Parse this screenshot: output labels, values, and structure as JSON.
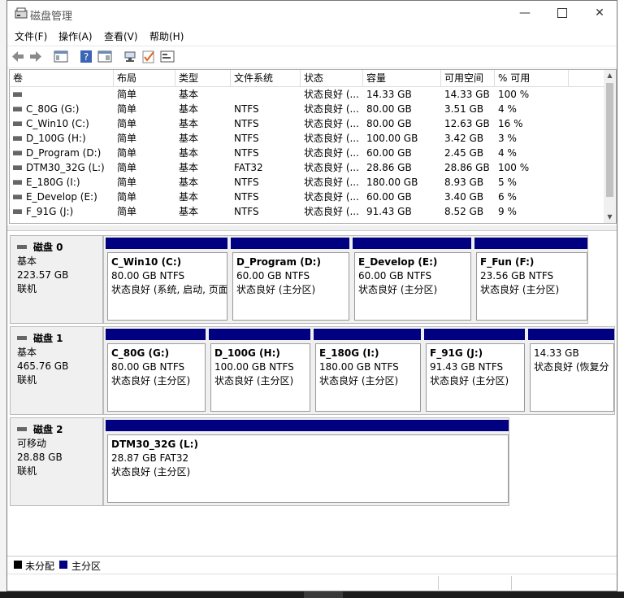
{
  "window": {
    "title": "磁盘管理"
  },
  "menu": [
    "文件(F)",
    "操作(A)",
    "查看(V)",
    "帮助(H)"
  ],
  "toolbar": [
    "back-icon",
    "forward-icon",
    "console-tree-icon",
    "help-icon",
    "properties-icon",
    "connect-icon",
    "check-icon",
    "settings-icon"
  ],
  "list": {
    "columns": [
      "卷",
      "布局",
      "类型",
      "文件系统",
      "状态",
      "容量",
      "可用空间",
      "% 可用"
    ],
    "rows": [
      [
        "",
        "简单",
        "基本",
        "",
        "状态良好 (...",
        "14.33 GB",
        "14.33 GB",
        "100 %"
      ],
      [
        "C_80G (G:)",
        "简单",
        "基本",
        "NTFS",
        "状态良好 (...",
        "80.00 GB",
        "3.51 GB",
        "4 %"
      ],
      [
        "C_Win10 (C:)",
        "简单",
        "基本",
        "NTFS",
        "状态良好 (...",
        "80.00 GB",
        "12.63 GB",
        "16 %"
      ],
      [
        "D_100G (H:)",
        "简单",
        "基本",
        "NTFS",
        "状态良好 (...",
        "100.00 GB",
        "3.42 GB",
        "3 %"
      ],
      [
        "D_Program (D:)",
        "简单",
        "基本",
        "NTFS",
        "状态良好 (...",
        "60.00 GB",
        "2.45 GB",
        "4 %"
      ],
      [
        "DTM30_32G (L:)",
        "简单",
        "基本",
        "FAT32",
        "状态良好 (...",
        "28.86 GB",
        "28.86 GB",
        "100 %"
      ],
      [
        "E_180G (I:)",
        "简单",
        "基本",
        "NTFS",
        "状态良好 (...",
        "180.00 GB",
        "8.93 GB",
        "5 %"
      ],
      [
        "E_Develop (E:)",
        "简单",
        "基本",
        "NTFS",
        "状态良好 (...",
        "60.00 GB",
        "3.40 GB",
        "6 %"
      ],
      [
        "F_91G (J:)",
        "简单",
        "基本",
        "NTFS",
        "状态良好 (...",
        "91.43 GB",
        "8.52 GB",
        "9 %"
      ]
    ]
  },
  "disks": [
    {
      "name": "磁盘 0",
      "kind": "基本",
      "size": "223.57 GB",
      "state": "联机",
      "partitions": [
        {
          "name": "C_Win10  (C:)",
          "size": "80.00 GB NTFS",
          "status": "状态良好 (系统, 启动, 页面"
        },
        {
          "name": "D_Program  (D:)",
          "size": "60.00 GB NTFS",
          "status": "状态良好 (主分区)"
        },
        {
          "name": "E_Develop  (E:)",
          "size": "60.00 GB NTFS",
          "status": "状态良好 (主分区)"
        },
        {
          "name": "F_Fun  (F:)",
          "size": "23.56 GB NTFS",
          "status": "状态良好 (主分区)"
        }
      ]
    },
    {
      "name": "磁盘 1",
      "kind": "基本",
      "size": "465.76 GB",
      "state": "联机",
      "partitions": [
        {
          "name": "C_80G  (G:)",
          "size": "80.00 GB NTFS",
          "status": "状态良好 (主分区)"
        },
        {
          "name": "D_100G  (H:)",
          "size": "100.00 GB NTFS",
          "status": "状态良好 (主分区)"
        },
        {
          "name": "E_180G  (I:)",
          "size": "180.00 GB NTFS",
          "status": "状态良好 (主分区)"
        },
        {
          "name": "F_91G  (J:)",
          "size": "91.43 GB NTFS",
          "status": "状态良好 (主分区)"
        },
        {
          "name": "",
          "size": "14.33 GB",
          "status": "状态良好 (恢复分"
        }
      ]
    },
    {
      "name": "磁盘 2",
      "kind": "可移动",
      "size": "28.88 GB",
      "state": "联机",
      "partitions": [
        {
          "name": "DTM30_32G  (L:)",
          "size": "28.87 GB FAT32",
          "status": "状态良好 (主分区)"
        }
      ]
    }
  ],
  "legend": {
    "unallocated": "未分配",
    "primary": "主分区",
    "unallocated_color": "#000000",
    "primary_color": "#000080"
  }
}
